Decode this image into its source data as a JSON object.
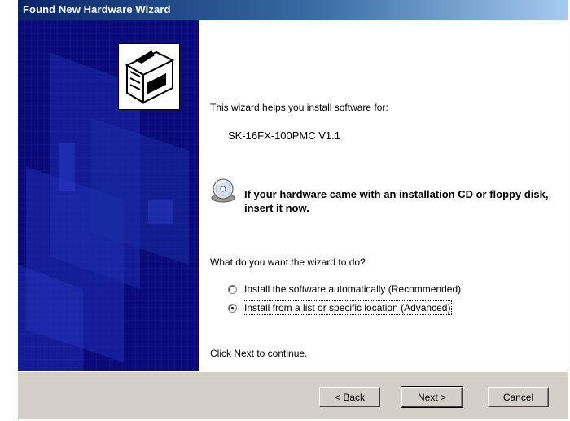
{
  "window": {
    "title": "Found New Hardware Wizard"
  },
  "content": {
    "intro": "This wizard helps you install software for:",
    "device_name": "SK-16FX-100PMC V1.1",
    "insert_notice": "If your hardware came with an installation CD or floppy disk, insert it now.",
    "question": "What do you want the wizard to do?",
    "options": [
      {
        "label": "Install the software automatically (Recommended)",
        "selected": false
      },
      {
        "label": "Install from a list or specific location (Advanced)",
        "selected": true
      }
    ],
    "continue_text": "Click Next to continue."
  },
  "buttons": {
    "back": "< Back",
    "next": "Next >",
    "cancel": "Cancel"
  },
  "colors": {
    "title_bar": "#0a246a",
    "side_panel": "#0b0b78",
    "dialog_face": "#d4d0c8"
  }
}
